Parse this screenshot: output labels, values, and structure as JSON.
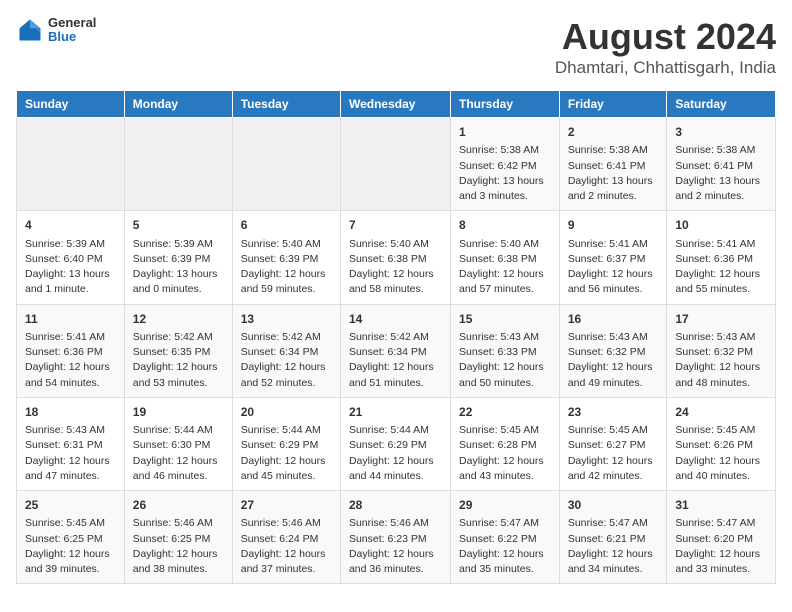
{
  "header": {
    "logo_general": "General",
    "logo_blue": "Blue",
    "title": "August 2024",
    "subtitle": "Dhamtari, Chhattisgarh, India"
  },
  "weekdays": [
    "Sunday",
    "Monday",
    "Tuesday",
    "Wednesday",
    "Thursday",
    "Friday",
    "Saturday"
  ],
  "weeks": [
    [
      {
        "day": "",
        "text": ""
      },
      {
        "day": "",
        "text": ""
      },
      {
        "day": "",
        "text": ""
      },
      {
        "day": "",
        "text": ""
      },
      {
        "day": "1",
        "text": "Sunrise: 5:38 AM\nSunset: 6:42 PM\nDaylight: 13 hours\nand 3 minutes."
      },
      {
        "day": "2",
        "text": "Sunrise: 5:38 AM\nSunset: 6:41 PM\nDaylight: 13 hours\nand 2 minutes."
      },
      {
        "day": "3",
        "text": "Sunrise: 5:38 AM\nSunset: 6:41 PM\nDaylight: 13 hours\nand 2 minutes."
      }
    ],
    [
      {
        "day": "4",
        "text": "Sunrise: 5:39 AM\nSunset: 6:40 PM\nDaylight: 13 hours\nand 1 minute."
      },
      {
        "day": "5",
        "text": "Sunrise: 5:39 AM\nSunset: 6:39 PM\nDaylight: 13 hours\nand 0 minutes."
      },
      {
        "day": "6",
        "text": "Sunrise: 5:40 AM\nSunset: 6:39 PM\nDaylight: 12 hours\nand 59 minutes."
      },
      {
        "day": "7",
        "text": "Sunrise: 5:40 AM\nSunset: 6:38 PM\nDaylight: 12 hours\nand 58 minutes."
      },
      {
        "day": "8",
        "text": "Sunrise: 5:40 AM\nSunset: 6:38 PM\nDaylight: 12 hours\nand 57 minutes."
      },
      {
        "day": "9",
        "text": "Sunrise: 5:41 AM\nSunset: 6:37 PM\nDaylight: 12 hours\nand 56 minutes."
      },
      {
        "day": "10",
        "text": "Sunrise: 5:41 AM\nSunset: 6:36 PM\nDaylight: 12 hours\nand 55 minutes."
      }
    ],
    [
      {
        "day": "11",
        "text": "Sunrise: 5:41 AM\nSunset: 6:36 PM\nDaylight: 12 hours\nand 54 minutes."
      },
      {
        "day": "12",
        "text": "Sunrise: 5:42 AM\nSunset: 6:35 PM\nDaylight: 12 hours\nand 53 minutes."
      },
      {
        "day": "13",
        "text": "Sunrise: 5:42 AM\nSunset: 6:34 PM\nDaylight: 12 hours\nand 52 minutes."
      },
      {
        "day": "14",
        "text": "Sunrise: 5:42 AM\nSunset: 6:34 PM\nDaylight: 12 hours\nand 51 minutes."
      },
      {
        "day": "15",
        "text": "Sunrise: 5:43 AM\nSunset: 6:33 PM\nDaylight: 12 hours\nand 50 minutes."
      },
      {
        "day": "16",
        "text": "Sunrise: 5:43 AM\nSunset: 6:32 PM\nDaylight: 12 hours\nand 49 minutes."
      },
      {
        "day": "17",
        "text": "Sunrise: 5:43 AM\nSunset: 6:32 PM\nDaylight: 12 hours\nand 48 minutes."
      }
    ],
    [
      {
        "day": "18",
        "text": "Sunrise: 5:43 AM\nSunset: 6:31 PM\nDaylight: 12 hours\nand 47 minutes."
      },
      {
        "day": "19",
        "text": "Sunrise: 5:44 AM\nSunset: 6:30 PM\nDaylight: 12 hours\nand 46 minutes."
      },
      {
        "day": "20",
        "text": "Sunrise: 5:44 AM\nSunset: 6:29 PM\nDaylight: 12 hours\nand 45 minutes."
      },
      {
        "day": "21",
        "text": "Sunrise: 5:44 AM\nSunset: 6:29 PM\nDaylight: 12 hours\nand 44 minutes."
      },
      {
        "day": "22",
        "text": "Sunrise: 5:45 AM\nSunset: 6:28 PM\nDaylight: 12 hours\nand 43 minutes."
      },
      {
        "day": "23",
        "text": "Sunrise: 5:45 AM\nSunset: 6:27 PM\nDaylight: 12 hours\nand 42 minutes."
      },
      {
        "day": "24",
        "text": "Sunrise: 5:45 AM\nSunset: 6:26 PM\nDaylight: 12 hours\nand 40 minutes."
      }
    ],
    [
      {
        "day": "25",
        "text": "Sunrise: 5:45 AM\nSunset: 6:25 PM\nDaylight: 12 hours\nand 39 minutes."
      },
      {
        "day": "26",
        "text": "Sunrise: 5:46 AM\nSunset: 6:25 PM\nDaylight: 12 hours\nand 38 minutes."
      },
      {
        "day": "27",
        "text": "Sunrise: 5:46 AM\nSunset: 6:24 PM\nDaylight: 12 hours\nand 37 minutes."
      },
      {
        "day": "28",
        "text": "Sunrise: 5:46 AM\nSunset: 6:23 PM\nDaylight: 12 hours\nand 36 minutes."
      },
      {
        "day": "29",
        "text": "Sunrise: 5:47 AM\nSunset: 6:22 PM\nDaylight: 12 hours\nand 35 minutes."
      },
      {
        "day": "30",
        "text": "Sunrise: 5:47 AM\nSunset: 6:21 PM\nDaylight: 12 hours\nand 34 minutes."
      },
      {
        "day": "31",
        "text": "Sunrise: 5:47 AM\nSunset: 6:20 PM\nDaylight: 12 hours\nand 33 minutes."
      }
    ]
  ]
}
